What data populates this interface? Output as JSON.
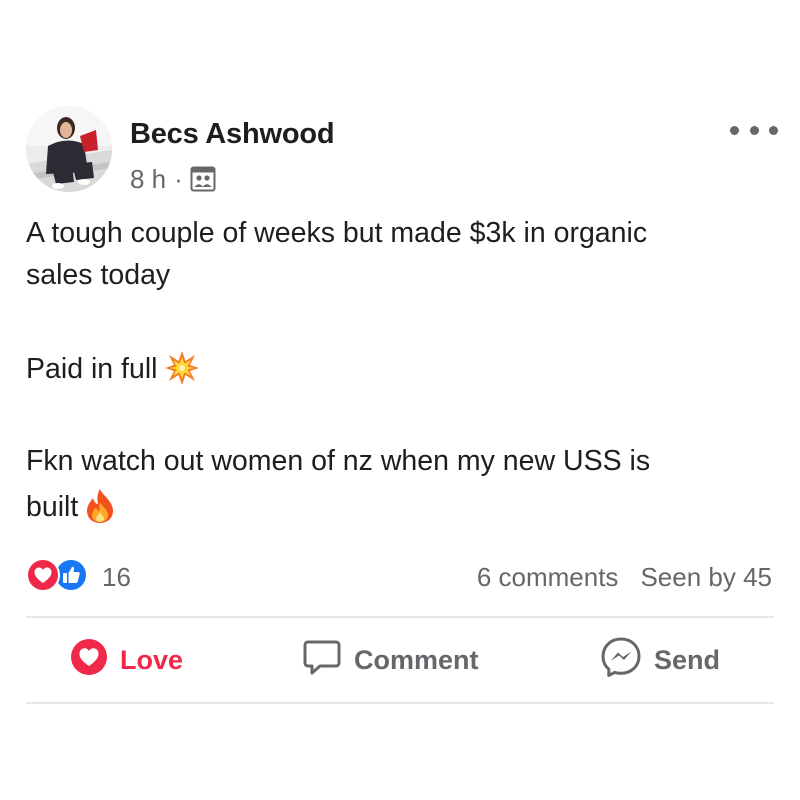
{
  "post": {
    "author_name": "Becs Ashwood",
    "timestamp": "8 h",
    "separator": "·",
    "audience_icon": "group-audience-icon",
    "more_icon": "more-options-icon",
    "paragraphs": [
      "A tough couple of weeks but made $3k in organic",
      "sales today",
      "Paid in full",
      "Fkn watch out women of nz when my new USS is",
      "built"
    ],
    "emojis": [
      "collision-icon",
      "fire-icon"
    ]
  },
  "reactions": {
    "icons": [
      "love-reaction-icon",
      "like-reaction-icon"
    ],
    "count": "16",
    "comments": "6 comments",
    "seen_by": "Seen by 45"
  },
  "actions": {
    "love_label": "Love",
    "comment_label": "Comment",
    "send_label": "Send"
  },
  "colors": {
    "love_red": "#f02849",
    "like_blue": "#1877f2",
    "secondary_text": "#65676b",
    "divider": "#e4e6eb"
  }
}
